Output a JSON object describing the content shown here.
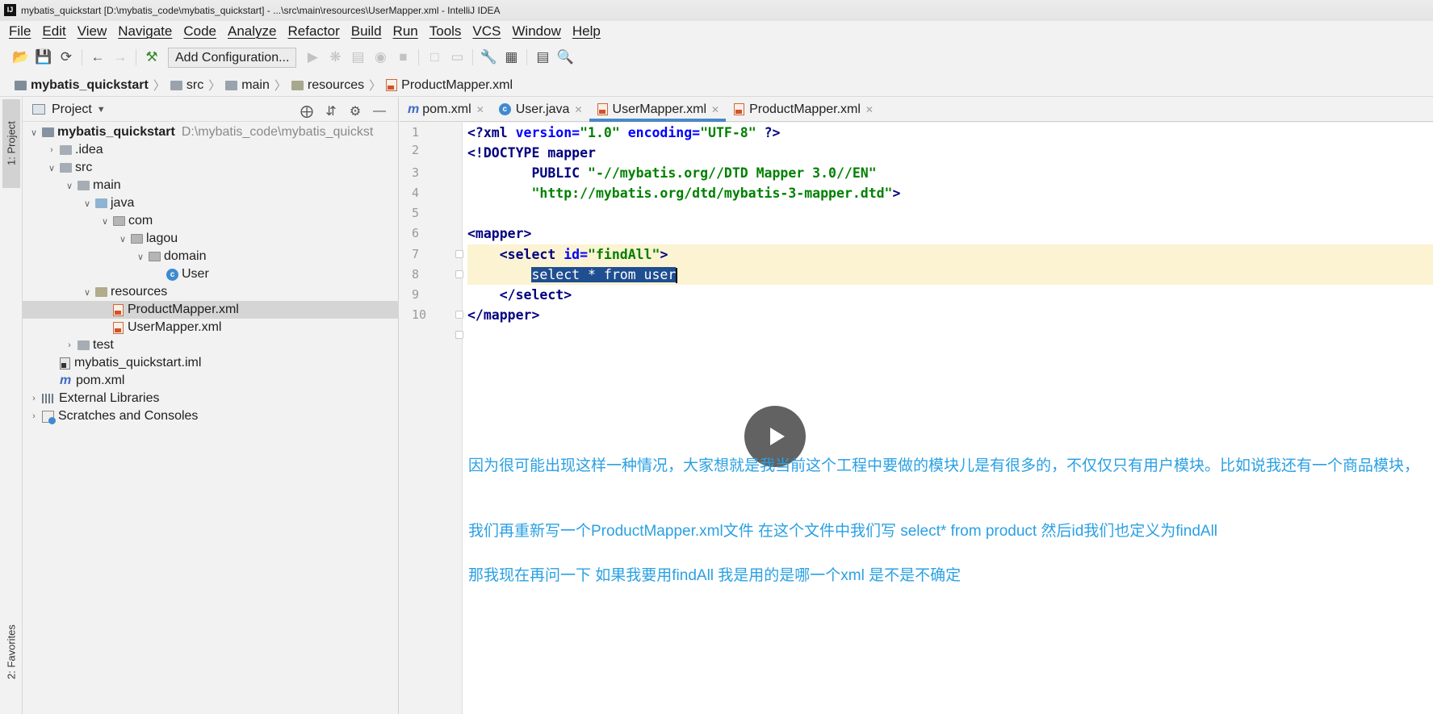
{
  "window": {
    "title": "mybatis_quickstart [D:\\mybatis_code\\mybatis_quickstart] - ...\\src\\main\\resources\\UserMapper.xml - IntelliJ IDEA",
    "app_icon": "IJ"
  },
  "menu": [
    "File",
    "Edit",
    "View",
    "Navigate",
    "Code",
    "Analyze",
    "Refactor",
    "Build",
    "Run",
    "Tools",
    "VCS",
    "Window",
    "Help"
  ],
  "toolbar": {
    "add_configuration": "Add Configuration...",
    "icons": [
      "open-folder-icon",
      "save-icon",
      "sync-icon",
      "back-arrow-icon",
      "forward-arrow-icon",
      "build-hammer-icon",
      "run-icon",
      "debug-icon",
      "coverage-icon",
      "profile-icon",
      "stop-icon",
      "attach-icon",
      "settings-wrench-icon",
      "project-structure-icon",
      "terminal-icon",
      "search-icon"
    ]
  },
  "breadcrumb": {
    "project": "mybatis_quickstart",
    "src": "src",
    "main": "main",
    "resources": "resources",
    "file": "ProductMapper.xml"
  },
  "stripe": {
    "project": "1: Project",
    "favorites": "2: Favorites"
  },
  "project_panel": {
    "title": "Project"
  },
  "tree": {
    "root_name": "mybatis_quickstart",
    "root_path": "D:\\mybatis_code\\mybatis_quickst",
    "idea": ".idea",
    "src": "src",
    "main": "main",
    "java": "java",
    "com": "com",
    "lagou": "lagou",
    "domain": "domain",
    "user": "User",
    "resources": "resources",
    "product_mapper": "ProductMapper.xml",
    "user_mapper": "UserMapper.xml",
    "test": "test",
    "iml": "mybatis_quickstart.iml",
    "pom": "pom.xml",
    "ext_libs": "External Libraries",
    "scratches": "Scratches and Consoles"
  },
  "tabs": {
    "pom": "pom.xml",
    "user_java": "User.java",
    "user_mapper": "UserMapper.xml",
    "product_mapper": "ProductMapper.xml"
  },
  "editor": {
    "line_numbers": [
      "1",
      "2",
      "3",
      "4",
      "5",
      "6",
      "7",
      "8",
      "9",
      "10"
    ],
    "l1": {
      "a": "<?xml ",
      "b": "version=",
      "c": "\"1.0\"",
      "d": " encoding=",
      "e": "\"UTF-8\"",
      "f": " ?>"
    },
    "l2": {
      "a": "<!DOCTYPE mapper"
    },
    "l3": {
      "a": "        PUBLIC ",
      "b": "\"-//mybatis.org//DTD Mapper 3.0//EN\""
    },
    "l4": {
      "a": "        \"http://mybatis.org/dtd/mybatis-3-mapper.dtd\"",
      "b": ">"
    },
    "l6": {
      "a": "<mapper>"
    },
    "l7": {
      "a": "    <select ",
      "b": "id=",
      "c": "\"findAll\"",
      "d": ">"
    },
    "l8": {
      "a": "        ",
      "b": "select * from user"
    },
    "l9": {
      "a": "    </select>"
    },
    "l10": {
      "a": "</mapper>"
    }
  },
  "annotations": {
    "p1": "因为很可能出现这样一种情况，大家想就是我当前这个工程中要做的模块儿是有很多的，不仅仅只有用户模块。比如说我还有一个商品模块，",
    "p2": "我们再重新写一个ProductMapper.xml文件 在这个文件中我们写  select* from product    然后id我们也定义为findAll",
    "p3": "那我现在再问一下 如果我要用findAll 我是用的是哪一个xml  是不是不确定"
  },
  "colors": {
    "annotation": "#2aa0e3",
    "selection": "#1f4e91",
    "current_line": "#fcf3d2",
    "active_tab": "#4a88c7"
  }
}
